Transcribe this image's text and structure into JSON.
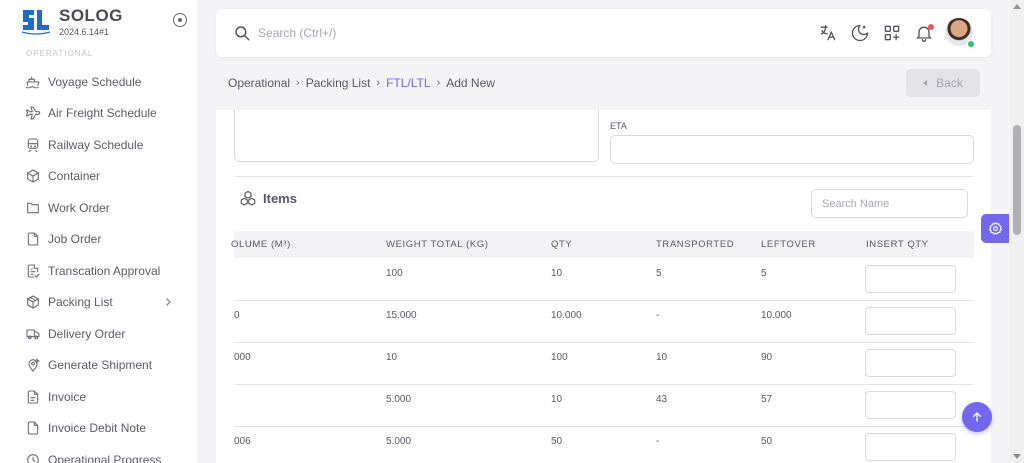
{
  "brand": {
    "name": "SOLOG",
    "version": "2024.6.14#1",
    "logo_small_text": "S•L",
    "accent": "#1d6ec8"
  },
  "sidebar": {
    "section_label": "OPERATIONAL",
    "items": [
      {
        "label": "Voyage Schedule",
        "icon": "ship-icon"
      },
      {
        "label": "Air Freight Schedule",
        "icon": "plane-icon"
      },
      {
        "label": "Railway Schedule",
        "icon": "train-icon"
      },
      {
        "label": "Container",
        "icon": "box-icon"
      },
      {
        "label": "Work Order",
        "icon": "folder-icon"
      },
      {
        "label": "Job Order",
        "icon": "file-icon"
      },
      {
        "label": "Transcation Approval",
        "icon": "file-check-icon"
      },
      {
        "label": "Packing List",
        "icon": "package-icon",
        "has_submenu": true
      },
      {
        "label": "Delivery Order",
        "icon": "truck-icon"
      },
      {
        "label": "Generate Shipment",
        "icon": "map-pin-icon"
      },
      {
        "label": "Invoice",
        "icon": "invoice-icon"
      },
      {
        "label": "Invoice Debit Note",
        "icon": "invoice-icon"
      },
      {
        "label": "Operational Progress",
        "icon": "progress-icon"
      }
    ]
  },
  "topbar": {
    "search_placeholder": "Search (Ctrl+/)",
    "icons": [
      "translate-icon",
      "moon-icon",
      "apps-add-icon",
      "bell-icon"
    ]
  },
  "breadcrumb": {
    "items": [
      "Operational",
      "Packing List",
      "FTL/LTL",
      "Add New"
    ],
    "separator": "›",
    "active_index": 2
  },
  "back_button": {
    "label": "Back"
  },
  "form": {
    "eta_label": "ETA",
    "eta_value": ""
  },
  "items_section": {
    "title": "Items",
    "search_placeholder": "Search Name",
    "columns": [
      "OLUME (M³)",
      "WEIGHT TOTAL (KG)",
      "QTY",
      "TRANSPORTED",
      "LEFTOVER",
      "INSERT QTY"
    ],
    "rows": [
      {
        "volume": "",
        "weight": "100",
        "qty": "10",
        "transported": "5",
        "leftover": "5"
      },
      {
        "volume": "0",
        "weight": "15.000",
        "qty": "10.000",
        "transported": "-",
        "leftover": "10.000"
      },
      {
        "volume": "000",
        "weight": "10",
        "qty": "100",
        "transported": "10",
        "leftover": "90"
      },
      {
        "volume": "",
        "weight": "5.000",
        "qty": "10",
        "transported": "43",
        "leftover": "57"
      },
      {
        "volume": "006",
        "weight": "5.000",
        "qty": "50",
        "transported": "-",
        "leftover": "50"
      }
    ]
  },
  "colors": {
    "primary": "#7367f0",
    "danger": "#ea5455",
    "success": "#28c76f"
  }
}
